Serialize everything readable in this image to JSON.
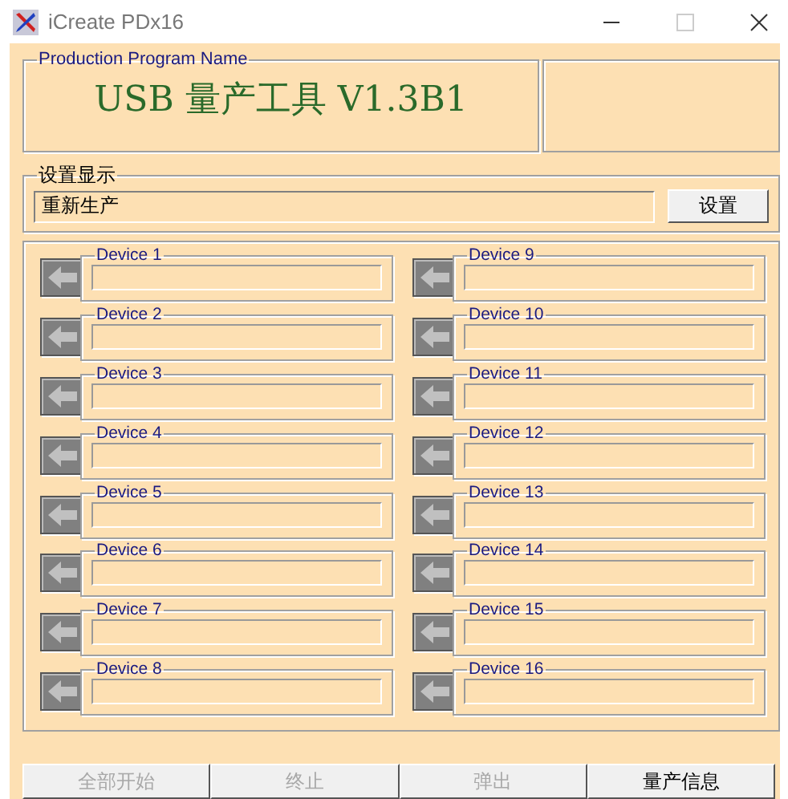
{
  "window": {
    "title": "iCreate PDx16"
  },
  "program": {
    "label": "Production Program Name",
    "name": "USB 量产工具 V1.3B1"
  },
  "settings": {
    "label": "设置显示",
    "value": "重新生产",
    "button": "设置"
  },
  "devices": [
    {
      "label": "Device 1"
    },
    {
      "label": "Device 2"
    },
    {
      "label": "Device 3"
    },
    {
      "label": "Device 4"
    },
    {
      "label": "Device 5"
    },
    {
      "label": "Device 6"
    },
    {
      "label": "Device 7"
    },
    {
      "label": "Device 8"
    },
    {
      "label": "Device 9"
    },
    {
      "label": "Device 10"
    },
    {
      "label": "Device 11"
    },
    {
      "label": "Device 12"
    },
    {
      "label": "Device 13"
    },
    {
      "label": "Device 14"
    },
    {
      "label": "Device 15"
    },
    {
      "label": "Device 16"
    }
  ],
  "buttons": [
    {
      "label": "全部开始",
      "disabled": true
    },
    {
      "label": "终止",
      "disabled": true
    },
    {
      "label": "弹出",
      "disabled": true
    },
    {
      "label": "量产信息",
      "disabled": false
    }
  ]
}
